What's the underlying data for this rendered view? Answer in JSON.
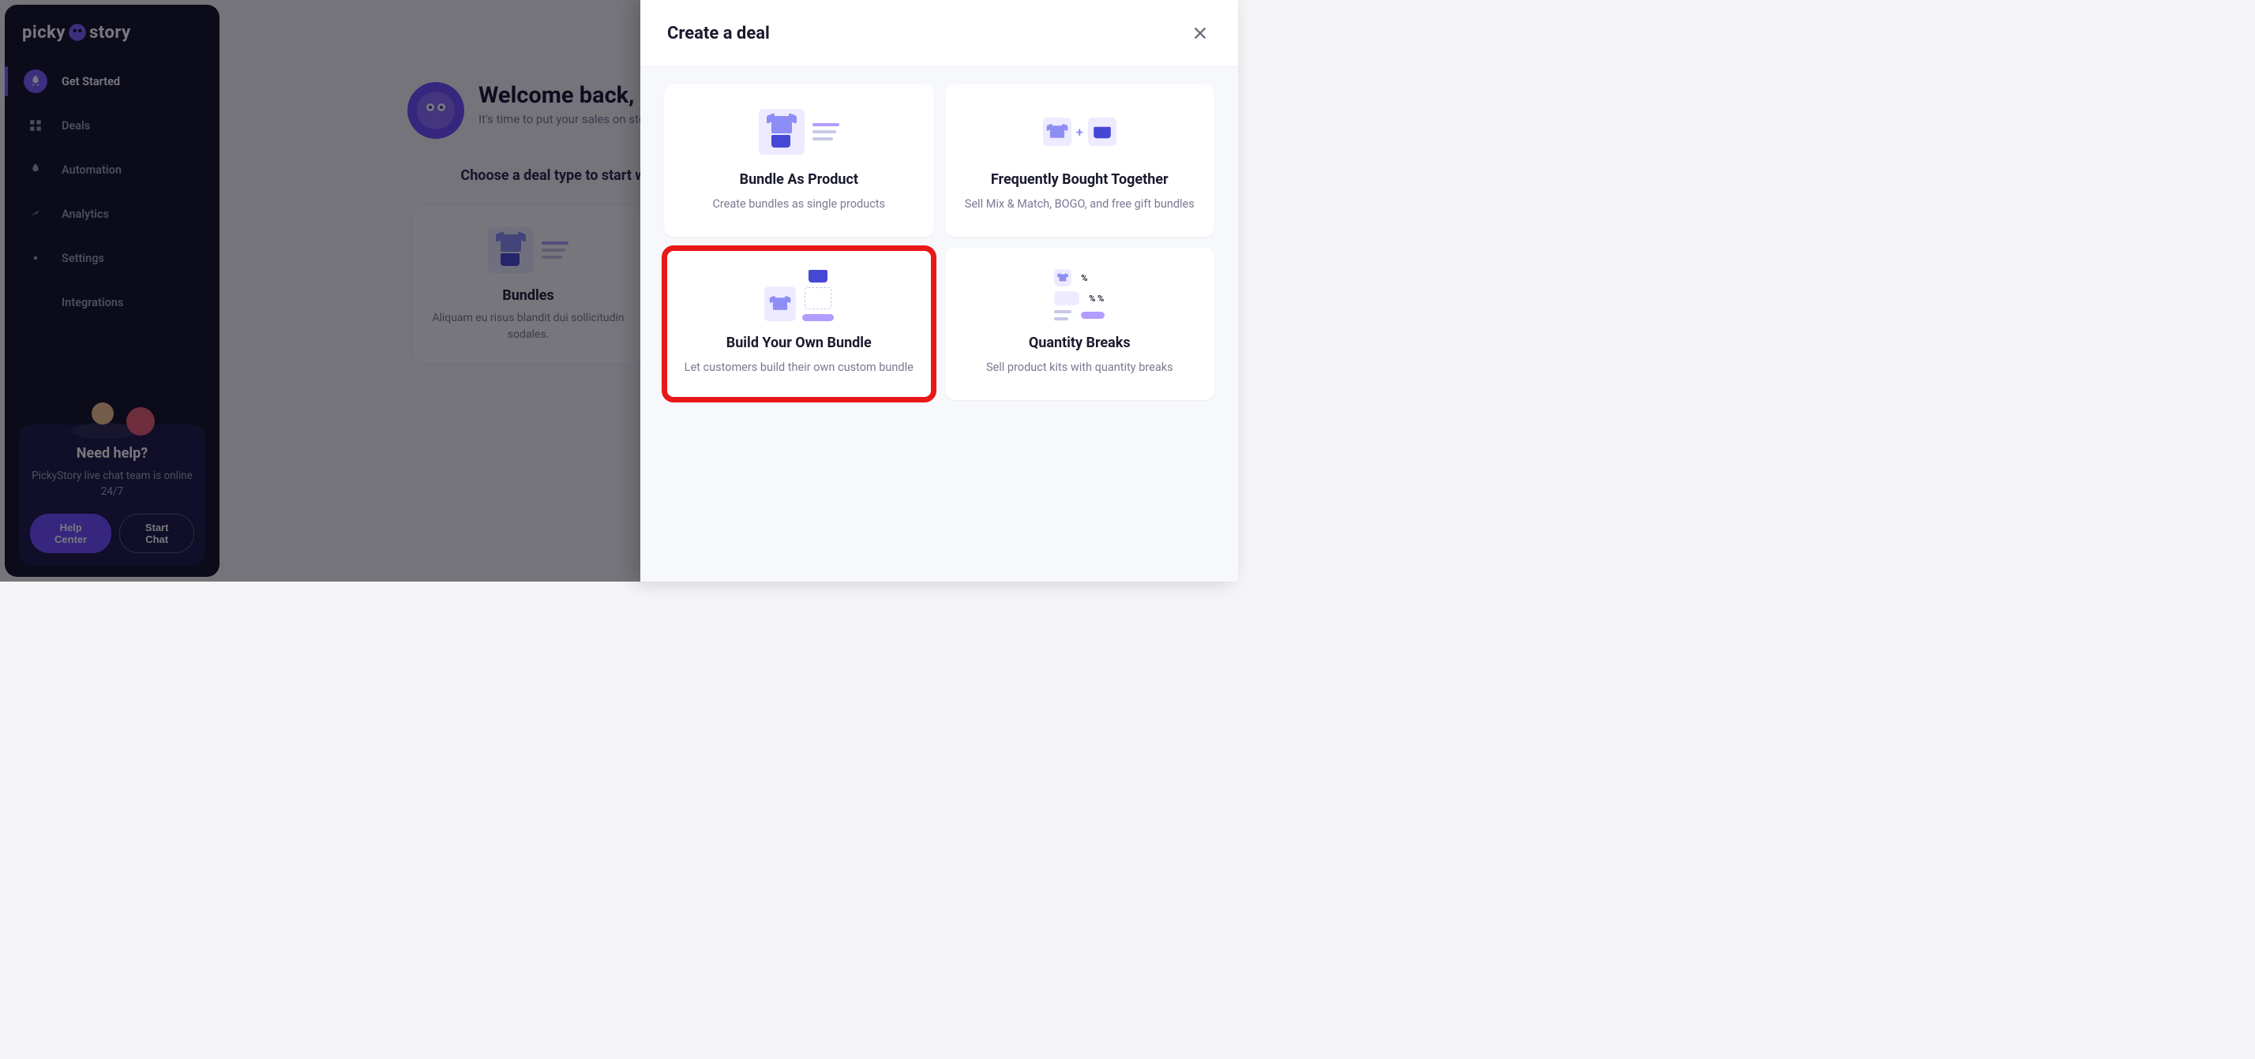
{
  "brand": {
    "name": "pickystory"
  },
  "sidebar": {
    "items": [
      {
        "label": "Get Started",
        "name": "nav-get-started",
        "active": true
      },
      {
        "label": "Deals",
        "name": "nav-deals",
        "active": false
      },
      {
        "label": "Automation",
        "name": "nav-automation",
        "active": false
      },
      {
        "label": "Analytics",
        "name": "nav-analytics",
        "active": false
      },
      {
        "label": "Settings",
        "name": "nav-settings",
        "active": false
      },
      {
        "label": "Integrations",
        "name": "nav-integrations",
        "active": false
      }
    ]
  },
  "help": {
    "title": "Need help?",
    "text": "PickyStory live chat team is online 24/7",
    "primary": "Help Center",
    "secondary": "Start Chat"
  },
  "main": {
    "welcome_title": "Welcome back, Euge",
    "welcome_sub": "It's time to put your sales on steroi",
    "choose_title": "Choose a deal type to start with",
    "cards": [
      {
        "title": "Bundles",
        "desc": "Aliquam eu risus blandit dui sollicitudin sodales."
      }
    ]
  },
  "modal": {
    "title": "Create a deal",
    "options": [
      {
        "title": "Bundle As Product",
        "desc": "Create bundles as single products",
        "name": "option-bundle-as-product",
        "highlight": false
      },
      {
        "title": "Frequently Bought Together",
        "desc": "Sell Mix & Match, BOGO, and free gift bundles",
        "name": "option-frequently-bought",
        "highlight": false
      },
      {
        "title": "Build Your Own Bundle",
        "desc": "Let customers build their own custom bundle",
        "name": "option-build-your-own",
        "highlight": true
      },
      {
        "title": "Quantity Breaks",
        "desc": "Sell product kits with quantity breaks",
        "name": "option-quantity-breaks",
        "highlight": false
      }
    ]
  }
}
